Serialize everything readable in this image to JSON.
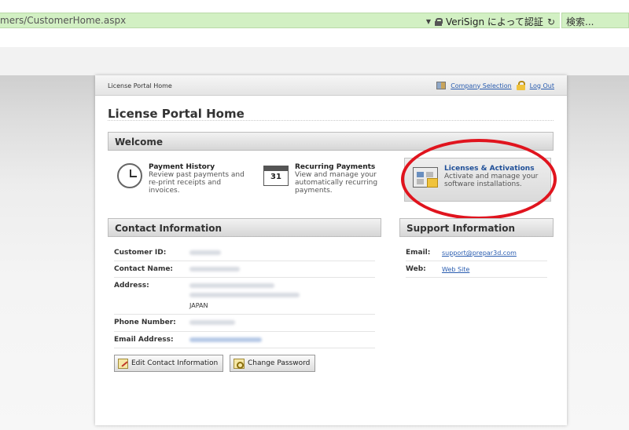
{
  "browser": {
    "url": "mers/CustomerHome.aspx",
    "cert_label": "VeriSign によって認証",
    "search_placeholder": "検索..."
  },
  "portal": {
    "breadcrumb": "License Portal Home",
    "company_selection": "Company Selection",
    "log_out": "Log Out",
    "title": "License Portal Home"
  },
  "welcome": {
    "heading": "Welcome",
    "items": [
      {
        "title": "Payment History",
        "desc": "Review past payments and re-print receipts and invoices.",
        "icon": "clock-icon"
      },
      {
        "title": "Recurring Payments",
        "desc": "View and manage your automatically recurring payments.",
        "icon": "calendar-icon",
        "icon_text": "31"
      },
      {
        "title": "Licenses & Activations",
        "desc": "Activate and manage your software installations.",
        "icon": "license-icon"
      }
    ]
  },
  "contact": {
    "heading": "Contact Information",
    "customer_id_label": "Customer ID:",
    "contact_name_label": "Contact Name:",
    "address_label": "Address:",
    "address_country": "JAPAN",
    "phone_label": "Phone Number:",
    "email_label": "Email Address:",
    "edit_button": "Edit Contact Information",
    "change_password_button": "Change Password"
  },
  "support": {
    "heading": "Support Information",
    "email_label": "Email:",
    "email_value": "support@prepar3d.com",
    "web_label": "Web:",
    "web_value": "Web Site"
  },
  "colors": {
    "address_bar": "#d2f0c3",
    "link": "#2a5db0",
    "highlight_title": "#1f4f98",
    "annotation_ring": "#e0141e"
  }
}
